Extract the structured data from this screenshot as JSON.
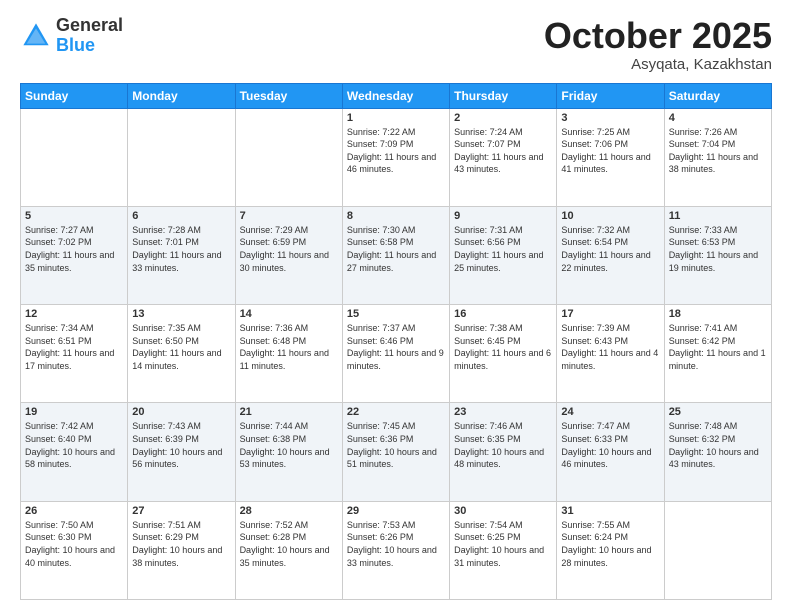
{
  "header": {
    "logo": {
      "general": "General",
      "blue": "Blue"
    },
    "title": "October 2025",
    "location": "Asyqata, Kazakhstan"
  },
  "weekdays": [
    "Sunday",
    "Monday",
    "Tuesday",
    "Wednesday",
    "Thursday",
    "Friday",
    "Saturday"
  ],
  "weeks": [
    [
      {
        "day": "",
        "sunrise": "",
        "sunset": "",
        "daylight": ""
      },
      {
        "day": "",
        "sunrise": "",
        "sunset": "",
        "daylight": ""
      },
      {
        "day": "",
        "sunrise": "",
        "sunset": "",
        "daylight": ""
      },
      {
        "day": "1",
        "sunrise": "Sunrise: 7:22 AM",
        "sunset": "Sunset: 7:09 PM",
        "daylight": "Daylight: 11 hours and 46 minutes."
      },
      {
        "day": "2",
        "sunrise": "Sunrise: 7:24 AM",
        "sunset": "Sunset: 7:07 PM",
        "daylight": "Daylight: 11 hours and 43 minutes."
      },
      {
        "day": "3",
        "sunrise": "Sunrise: 7:25 AM",
        "sunset": "Sunset: 7:06 PM",
        "daylight": "Daylight: 11 hours and 41 minutes."
      },
      {
        "day": "4",
        "sunrise": "Sunrise: 7:26 AM",
        "sunset": "Sunset: 7:04 PM",
        "daylight": "Daylight: 11 hours and 38 minutes."
      }
    ],
    [
      {
        "day": "5",
        "sunrise": "Sunrise: 7:27 AM",
        "sunset": "Sunset: 7:02 PM",
        "daylight": "Daylight: 11 hours and 35 minutes."
      },
      {
        "day": "6",
        "sunrise": "Sunrise: 7:28 AM",
        "sunset": "Sunset: 7:01 PM",
        "daylight": "Daylight: 11 hours and 33 minutes."
      },
      {
        "day": "7",
        "sunrise": "Sunrise: 7:29 AM",
        "sunset": "Sunset: 6:59 PM",
        "daylight": "Daylight: 11 hours and 30 minutes."
      },
      {
        "day": "8",
        "sunrise": "Sunrise: 7:30 AM",
        "sunset": "Sunset: 6:58 PM",
        "daylight": "Daylight: 11 hours and 27 minutes."
      },
      {
        "day": "9",
        "sunrise": "Sunrise: 7:31 AM",
        "sunset": "Sunset: 6:56 PM",
        "daylight": "Daylight: 11 hours and 25 minutes."
      },
      {
        "day": "10",
        "sunrise": "Sunrise: 7:32 AM",
        "sunset": "Sunset: 6:54 PM",
        "daylight": "Daylight: 11 hours and 22 minutes."
      },
      {
        "day": "11",
        "sunrise": "Sunrise: 7:33 AM",
        "sunset": "Sunset: 6:53 PM",
        "daylight": "Daylight: 11 hours and 19 minutes."
      }
    ],
    [
      {
        "day": "12",
        "sunrise": "Sunrise: 7:34 AM",
        "sunset": "Sunset: 6:51 PM",
        "daylight": "Daylight: 11 hours and 17 minutes."
      },
      {
        "day": "13",
        "sunrise": "Sunrise: 7:35 AM",
        "sunset": "Sunset: 6:50 PM",
        "daylight": "Daylight: 11 hours and 14 minutes."
      },
      {
        "day": "14",
        "sunrise": "Sunrise: 7:36 AM",
        "sunset": "Sunset: 6:48 PM",
        "daylight": "Daylight: 11 hours and 11 minutes."
      },
      {
        "day": "15",
        "sunrise": "Sunrise: 7:37 AM",
        "sunset": "Sunset: 6:46 PM",
        "daylight": "Daylight: 11 hours and 9 minutes."
      },
      {
        "day": "16",
        "sunrise": "Sunrise: 7:38 AM",
        "sunset": "Sunset: 6:45 PM",
        "daylight": "Daylight: 11 hours and 6 minutes."
      },
      {
        "day": "17",
        "sunrise": "Sunrise: 7:39 AM",
        "sunset": "Sunset: 6:43 PM",
        "daylight": "Daylight: 11 hours and 4 minutes."
      },
      {
        "day": "18",
        "sunrise": "Sunrise: 7:41 AM",
        "sunset": "Sunset: 6:42 PM",
        "daylight": "Daylight: 11 hours and 1 minute."
      }
    ],
    [
      {
        "day": "19",
        "sunrise": "Sunrise: 7:42 AM",
        "sunset": "Sunset: 6:40 PM",
        "daylight": "Daylight: 10 hours and 58 minutes."
      },
      {
        "day": "20",
        "sunrise": "Sunrise: 7:43 AM",
        "sunset": "Sunset: 6:39 PM",
        "daylight": "Daylight: 10 hours and 56 minutes."
      },
      {
        "day": "21",
        "sunrise": "Sunrise: 7:44 AM",
        "sunset": "Sunset: 6:38 PM",
        "daylight": "Daylight: 10 hours and 53 minutes."
      },
      {
        "day": "22",
        "sunrise": "Sunrise: 7:45 AM",
        "sunset": "Sunset: 6:36 PM",
        "daylight": "Daylight: 10 hours and 51 minutes."
      },
      {
        "day": "23",
        "sunrise": "Sunrise: 7:46 AM",
        "sunset": "Sunset: 6:35 PM",
        "daylight": "Daylight: 10 hours and 48 minutes."
      },
      {
        "day": "24",
        "sunrise": "Sunrise: 7:47 AM",
        "sunset": "Sunset: 6:33 PM",
        "daylight": "Daylight: 10 hours and 46 minutes."
      },
      {
        "day": "25",
        "sunrise": "Sunrise: 7:48 AM",
        "sunset": "Sunset: 6:32 PM",
        "daylight": "Daylight: 10 hours and 43 minutes."
      }
    ],
    [
      {
        "day": "26",
        "sunrise": "Sunrise: 7:50 AM",
        "sunset": "Sunset: 6:30 PM",
        "daylight": "Daylight: 10 hours and 40 minutes."
      },
      {
        "day": "27",
        "sunrise": "Sunrise: 7:51 AM",
        "sunset": "Sunset: 6:29 PM",
        "daylight": "Daylight: 10 hours and 38 minutes."
      },
      {
        "day": "28",
        "sunrise": "Sunrise: 7:52 AM",
        "sunset": "Sunset: 6:28 PM",
        "daylight": "Daylight: 10 hours and 35 minutes."
      },
      {
        "day": "29",
        "sunrise": "Sunrise: 7:53 AM",
        "sunset": "Sunset: 6:26 PM",
        "daylight": "Daylight: 10 hours and 33 minutes."
      },
      {
        "day": "30",
        "sunrise": "Sunrise: 7:54 AM",
        "sunset": "Sunset: 6:25 PM",
        "daylight": "Daylight: 10 hours and 31 minutes."
      },
      {
        "day": "31",
        "sunrise": "Sunrise: 7:55 AM",
        "sunset": "Sunset: 6:24 PM",
        "daylight": "Daylight: 10 hours and 28 minutes."
      },
      {
        "day": "",
        "sunrise": "",
        "sunset": "",
        "daylight": ""
      }
    ]
  ]
}
